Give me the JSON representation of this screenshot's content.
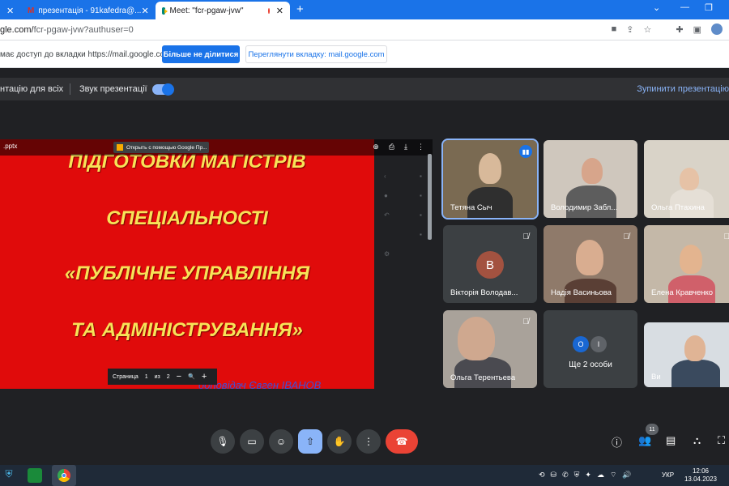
{
  "browser": {
    "tabs": [
      {
        "label": "презентація - 91kafedra@...",
        "close": "✕"
      },
      {
        "label": "Meet: \"fcr-pgaw-jvw\"",
        "close": "✕"
      }
    ],
    "first_tab_close": "✕",
    "url_prefix": "gle.com/",
    "url_path": "fcr-pgaw-jvw?authuser=0"
  },
  "share_banner": {
    "text": "має доступ до вкладки https://mail.google.com",
    "stop_button": "Більше не ділитися",
    "view_button": "Переглянути вкладку: mail.google.com"
  },
  "presenting_bar": {
    "left_label": "нтацію для всіх",
    "audio_label": "Звук презентації",
    "stop_label": "Зупинити презентацію"
  },
  "slide": {
    "file_name": ".pptx",
    "open_with": "Открыть с помощью Google Пр...",
    "lines": [
      "ПІДГОТОВКИ МАГІСТРІВ",
      "СПЕЦІАЛЬНОСТІ",
      "«ПУБЛІЧНЕ УПРАВЛІННЯ",
      "ТА АДМІНІСТРУВАННЯ»"
    ],
    "presenter": "доповідач Євген ІВАНОВ",
    "pager_label": "Страница",
    "pager_current": "1",
    "pager_of": "из",
    "pager_total": "2",
    "zoom_out": "−",
    "zoom_in": "+"
  },
  "participants": [
    {
      "name": "Тетяна Сыч",
      "muted": false,
      "speaking": true
    },
    {
      "name": "Володимир Забл...",
      "muted": false
    },
    {
      "name": "Ольга Птахина",
      "muted": false
    },
    {
      "name": "Вікторія Володав...",
      "muted": true,
      "initial": "В"
    },
    {
      "name": "Надія Васиньова",
      "muted": true
    },
    {
      "name": "Елена Кравченко",
      "muted": true
    },
    {
      "name": "Ольга Терентьева",
      "muted": true
    },
    {
      "name": "Ще 2 особи",
      "initials": [
        "О",
        "І"
      ]
    },
    {
      "name": "Ви"
    }
  ],
  "controls": {
    "participants_count": "11"
  },
  "taskbar": {
    "lang": "УКР",
    "time": "12:06",
    "date": "13.04.2023"
  }
}
